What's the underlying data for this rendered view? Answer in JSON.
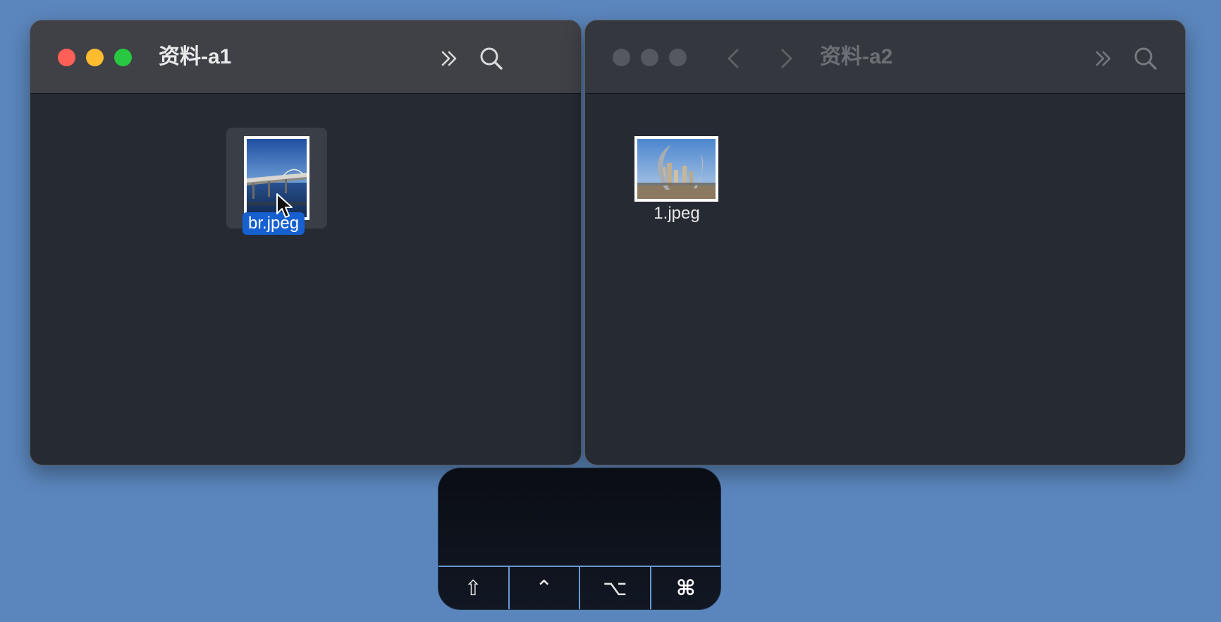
{
  "windows": {
    "a1": {
      "title": "资料-a1",
      "file": {
        "name": "br.jpeg",
        "selected": true
      }
    },
    "a2": {
      "title": "资料-a2",
      "file": {
        "name": "1.jpeg",
        "selected": false
      }
    }
  },
  "icons": {
    "back": "chevron-left-icon",
    "forward": "chevron-right-icon",
    "more": "double-chevron-right-icon",
    "search": "magnifier-icon",
    "cursor": "pointer-arrow-icon"
  },
  "keyboard_overlay": {
    "keys": [
      {
        "name": "shift",
        "glyph": "⇧"
      },
      {
        "name": "control",
        "glyph": "⌃"
      },
      {
        "name": "option",
        "glyph": "⌥"
      },
      {
        "name": "command",
        "glyph": "⌘",
        "active": true
      }
    ]
  },
  "colors": {
    "desktop": "#5b86bd",
    "window_bg": "#262a33",
    "titlebar": "#3f4147",
    "selection": "#1660d0",
    "close": "#fe5f57",
    "minimize": "#febc2e",
    "zoom": "#28c840"
  }
}
